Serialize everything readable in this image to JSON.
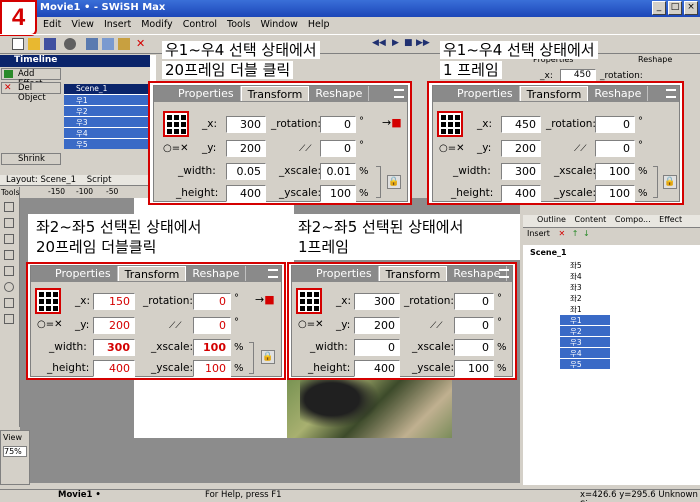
{
  "window": {
    "title": "Movie1 • - SWiSH Max",
    "step_number": "4",
    "minimize": "_",
    "restore": "□",
    "close": "×"
  },
  "menu": [
    "Edit",
    "View",
    "Insert",
    "Modify",
    "Control",
    "Tools",
    "Window",
    "Help"
  ],
  "left": {
    "timeline_title": "Timeline",
    "add_effect": "Add Effect",
    "del_object": "Del Object",
    "shrink": "Shrink",
    "layers": [
      "Scene_1",
      "우1",
      "우2",
      "우3",
      "우4",
      "우5"
    ],
    "layout_tab": "Layout: Scene_1",
    "script_tab": "Script",
    "ruler_labels": [
      "-150",
      "-100",
      "-50"
    ],
    "tools_label": "Tools",
    "view_label": "View",
    "zoom": "75%"
  },
  "status": {
    "tab": "Movie1 •",
    "help": "For Help, press F1",
    "coords": "x=426.6 y=295.6 Unknown Size"
  },
  "right": {
    "tabs": [
      "Properties",
      "Reshape"
    ],
    "x_label": "_x:",
    "x_value": "450",
    "rotation_label": "_rotation:",
    "outline_tabs": [
      "Outline",
      "Content",
      "Compo...",
      "Effect"
    ],
    "insert": "Insert",
    "scene": "Scene_1",
    "items": [
      "좌5",
      "좌4",
      "좌3",
      "좌2",
      "좌1",
      "우1",
      "우2",
      "우3",
      "우4",
      "우5"
    ]
  },
  "panels": [
    {
      "caption_line1": "우1~우4 선택 상태에서",
      "caption_line2": "20프레임 더블 클릭",
      "tabs": [
        "Properties",
        "Transform",
        "Reshape"
      ],
      "fields": {
        "x": "300",
        "y": "200",
        "width": "0.05",
        "height": "400",
        "rotation": "0",
        "skew": "0",
        "xscale": "0.01",
        "yscale": "100"
      }
    },
    {
      "caption_line1": "우1~우4 선택 상태에서",
      "caption_line2": "1 프레임",
      "tabs": [
        "Properties",
        "Transform",
        "Reshape"
      ],
      "fields": {
        "x": "450",
        "y": "200",
        "width": "300",
        "height": "400",
        "rotation": "0",
        "skew": "0",
        "xscale": "100",
        "yscale": "100"
      }
    },
    {
      "caption_line1": "좌2~좌5 선택된 상태에서",
      "caption_line2": "20프레임 더블클릭",
      "tabs": [
        "Properties",
        "Transform",
        "Reshape"
      ],
      "fields": {
        "x": "150",
        "y": "200",
        "width": "300",
        "height": "400",
        "rotation": "0",
        "skew": "0",
        "xscale": "100",
        "yscale": "100"
      }
    },
    {
      "caption_line1": "좌2~좌5 선택된 상태에서",
      "caption_line2": "1프레임",
      "tabs": [
        "Properties",
        "Transform",
        "Reshape"
      ],
      "fields": {
        "x": "300",
        "y": "200",
        "width": "0",
        "height": "400",
        "rotation": "0",
        "skew": "0",
        "xscale": "0",
        "yscale": "100"
      }
    }
  ],
  "labels": {
    "x": "_x:",
    "y": "_y:",
    "width": "_width:",
    "height": "_height:",
    "rotation": "_rotation:",
    "xscale": "_xscale:",
    "yscale": "_yscale:",
    "ox": "○=✕",
    "degree": "°",
    "percent": "%"
  },
  "colors": {
    "accent_red": "#d40000",
    "selection_blue": "#3a6ac6",
    "title_blue": "#1c46b8"
  }
}
